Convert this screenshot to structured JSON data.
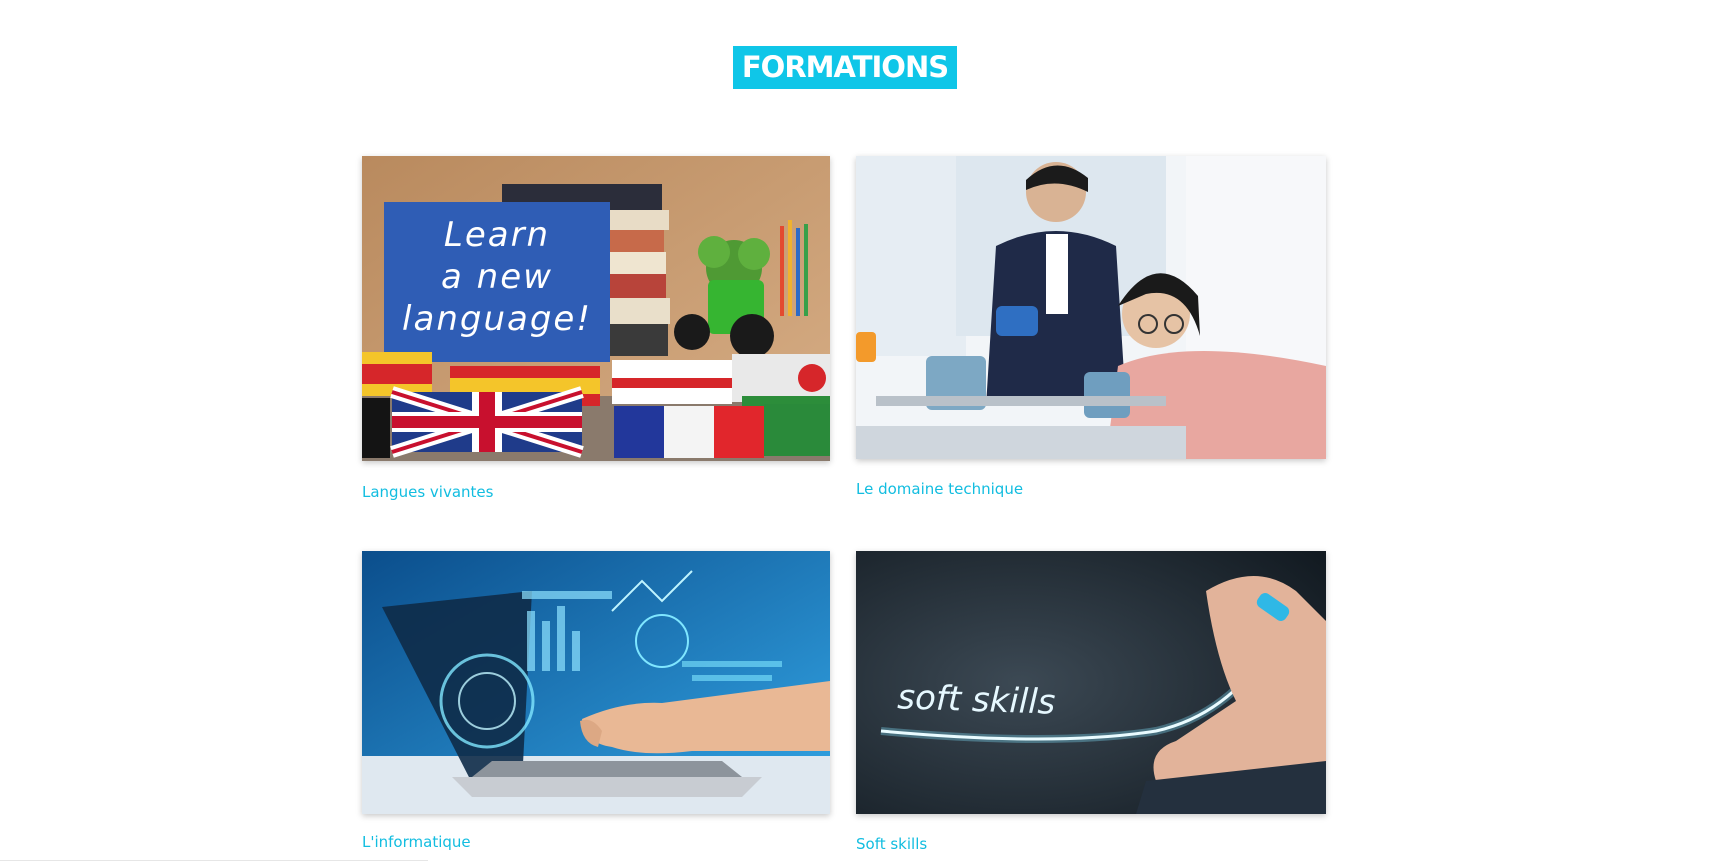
{
  "page": {
    "title": "FORMATIONS",
    "accent_color": "#0fc6e8"
  },
  "cards": [
    {
      "label": "Langues vivantes",
      "image_text": [
        "Learn",
        "a new",
        "language!"
      ]
    },
    {
      "label": "Le domaine technique"
    },
    {
      "label": "L'informatique"
    },
    {
      "label": "Soft skills",
      "image_text": "soft skills"
    }
  ]
}
